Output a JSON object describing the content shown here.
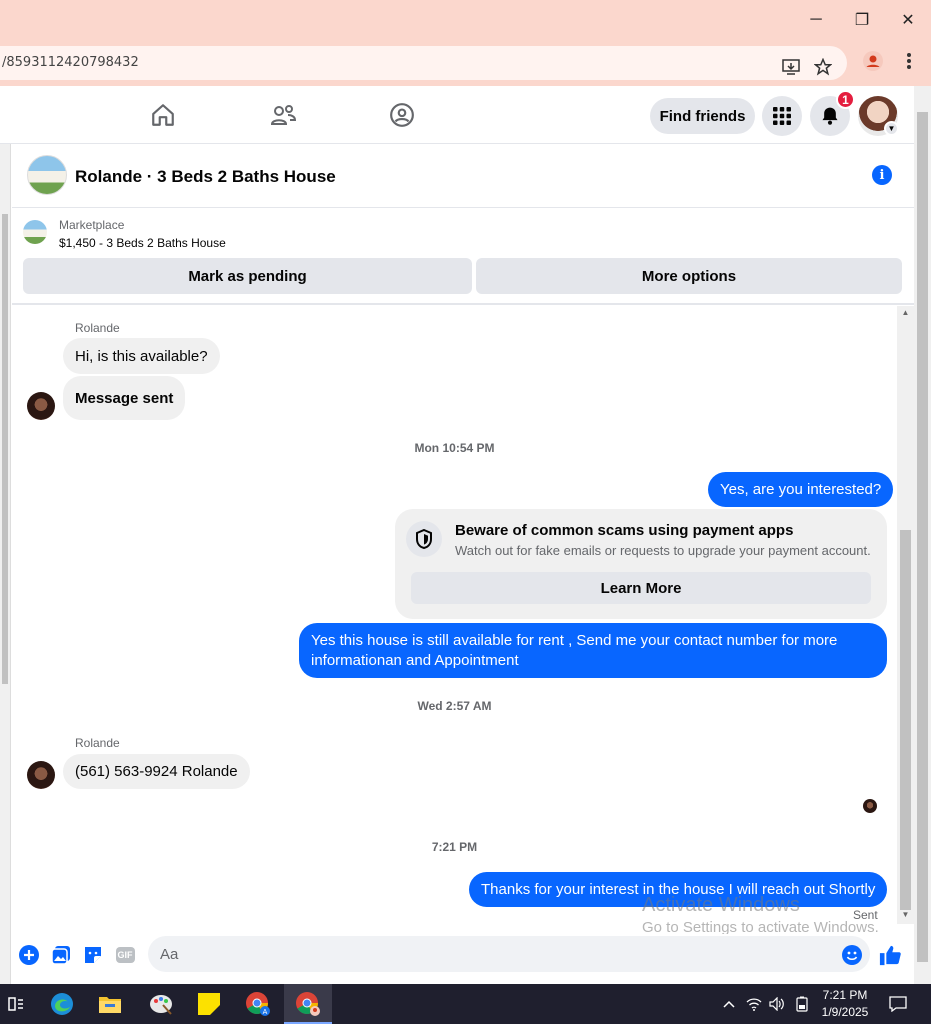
{
  "browser": {
    "url": "/8593112420798432",
    "window_controls": {
      "minimize": "─",
      "restore": "❐",
      "close": "✕"
    }
  },
  "nav": {
    "find_friends": "Find friends",
    "notification_count": "1"
  },
  "chat": {
    "title": "Rolande · 3 Beds 2 Baths House",
    "marketplace_label": "Marketplace",
    "listing": "$1,450 - 3 Beds 2 Baths House",
    "mark_pending": "Mark as pending",
    "more_options": "More options"
  },
  "messages": {
    "sender1": "Rolande",
    "m1": "Hi, is this available?",
    "m2": "Message sent",
    "stamp1": "Mon 10:54 PM",
    "m3": "Yes, are you interested?",
    "scam_title": "Beware of common scams using payment apps",
    "scam_body": "Watch out for fake emails or requests to upgrade your payment account.",
    "learn_more": "Learn More",
    "m4": "Yes this house is still available for rent , Send me your contact number for more informationan and Appointment",
    "stamp2": "Wed 2:57 AM",
    "sender2": "Rolande",
    "m5": "(561) 563-9924  Rolande",
    "stamp3": "7:21 PM",
    "m6": "Thanks for your interest in the house I will reach out Shortly",
    "sent": "Sent"
  },
  "composer": {
    "placeholder": "Aa",
    "gif": "GIF"
  },
  "watermark": {
    "line1": "Activate Windows",
    "line2": "Go to Settings to activate Windows."
  },
  "taskbar": {
    "time": "7:21 PM",
    "date": "1/9/2025"
  },
  "colors": {
    "accent": "#0866ff",
    "titlebar": "#fbd7cd",
    "badge": "#e41e3f"
  }
}
